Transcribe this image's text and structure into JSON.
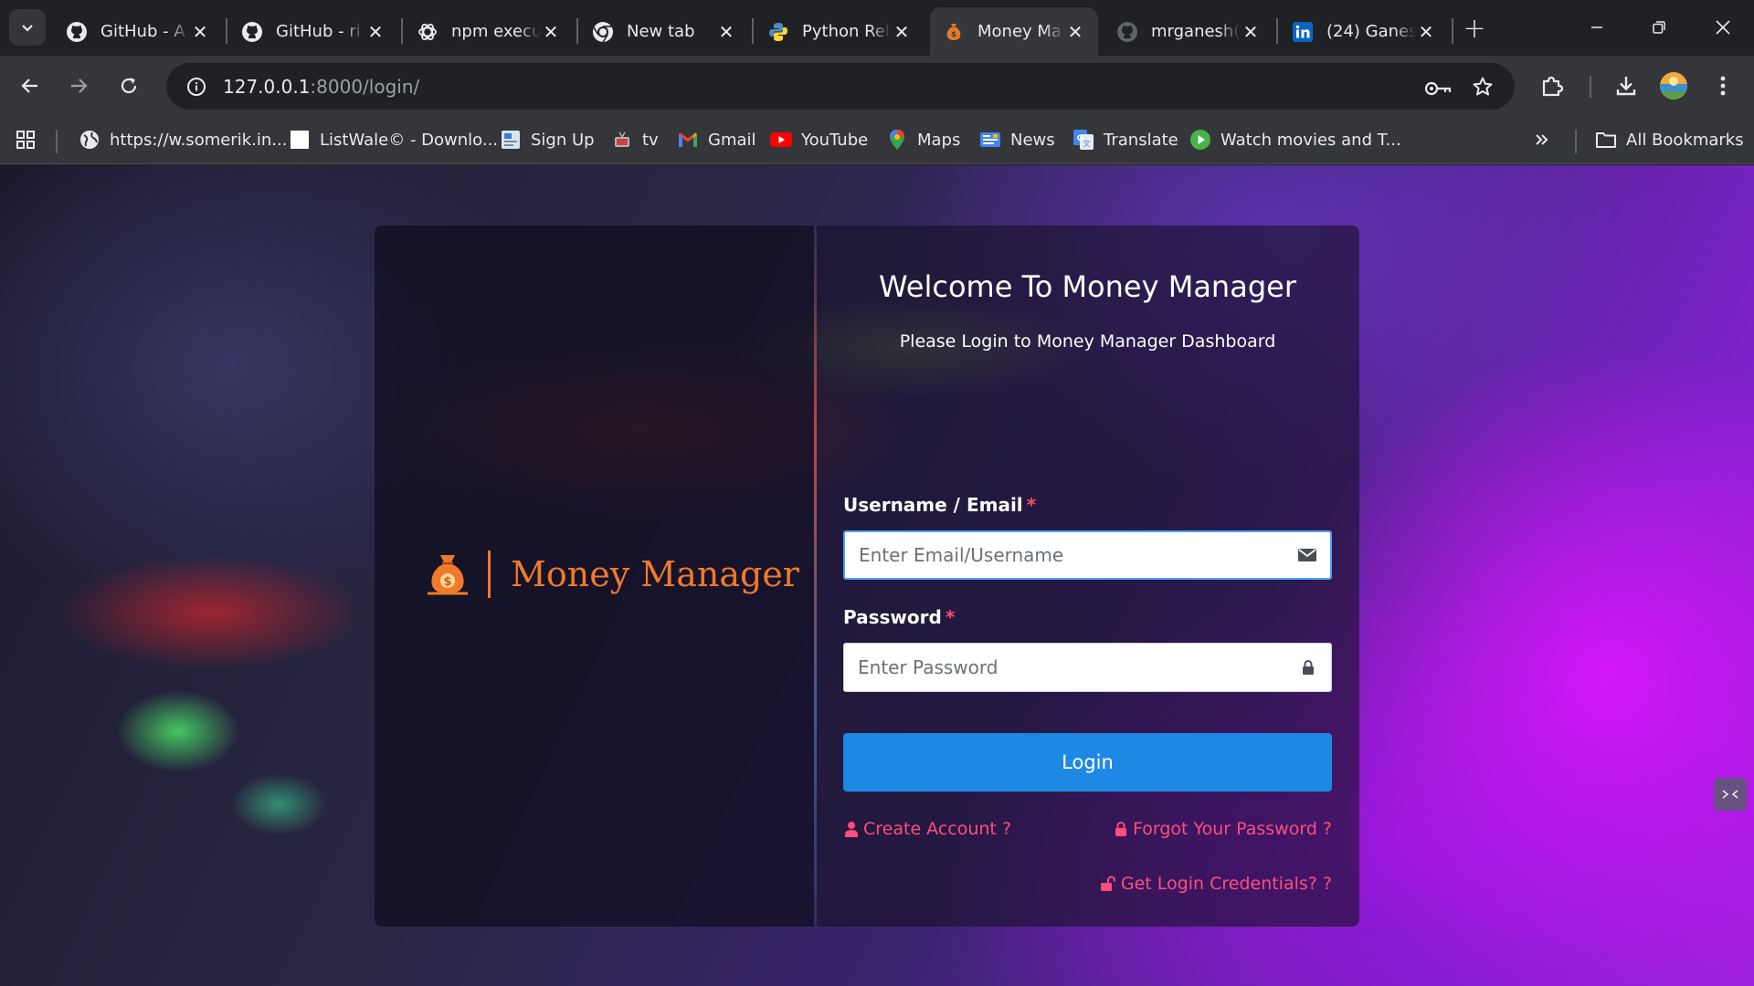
{
  "tabs": [
    {
      "title": "GitHub - A",
      "icon": "github-icon",
      "active": false
    },
    {
      "title": "GitHub - ri",
      "icon": "github-icon",
      "active": false
    },
    {
      "title": "npm execu",
      "icon": "chatgpt-icon",
      "active": false
    },
    {
      "title": "New tab",
      "icon": "chrome-icon",
      "active": false
    },
    {
      "title": "Python Rel",
      "icon": "python-icon",
      "active": false
    },
    {
      "title": "Money Ma",
      "icon": "money-bag-icon",
      "active": true
    },
    {
      "title": "mrganesh(",
      "icon": "github-icon",
      "active": false
    },
    {
      "title": "(24) Ganes",
      "icon": "linkedin-icon",
      "active": false
    }
  ],
  "address_bar": {
    "host": "127.0.0.1",
    "path": ":8000/login/"
  },
  "bookmarks": {
    "items": [
      {
        "label": "https://w.somerik.in...",
        "icon": "globe-icon"
      },
      {
        "label": "ListWale© - Downlo...",
        "icon": "blank-page-icon"
      },
      {
        "label": "Sign Up",
        "icon": "sign-up-icon"
      },
      {
        "label": "tv",
        "icon": "tv-icon"
      },
      {
        "label": "Gmail",
        "icon": "gmail-icon"
      },
      {
        "label": "YouTube",
        "icon": "youtube-icon"
      },
      {
        "label": "Maps",
        "icon": "maps-icon"
      },
      {
        "label": "News",
        "icon": "news-icon"
      },
      {
        "label": "Translate",
        "icon": "translate-icon"
      },
      {
        "label": "Watch movies and T...",
        "icon": "play-icon"
      }
    ],
    "all_bookmarks": "All Bookmarks"
  },
  "login": {
    "brand_name": "Money Manager",
    "welcome": "Welcome To Money Manager",
    "subtitle": "Please Login to Money Manager Dashboard",
    "username_label": "Username / Email",
    "username_placeholder": "Enter Email/Username",
    "password_label": "Password",
    "password_placeholder": "Enter Password",
    "required_mark": "*",
    "login_button": "Login",
    "create_account": "Create Account ?",
    "forgot_password": "Forgot Your Password ?",
    "get_credentials": "Get Login Credentials? ?"
  },
  "colors": {
    "brand_orange": "#f07a2a",
    "link_pink": "#ff4d7d",
    "button_blue": "#1e88e5",
    "chrome_dark": "#202124",
    "chrome_toolbar": "#35363a"
  }
}
